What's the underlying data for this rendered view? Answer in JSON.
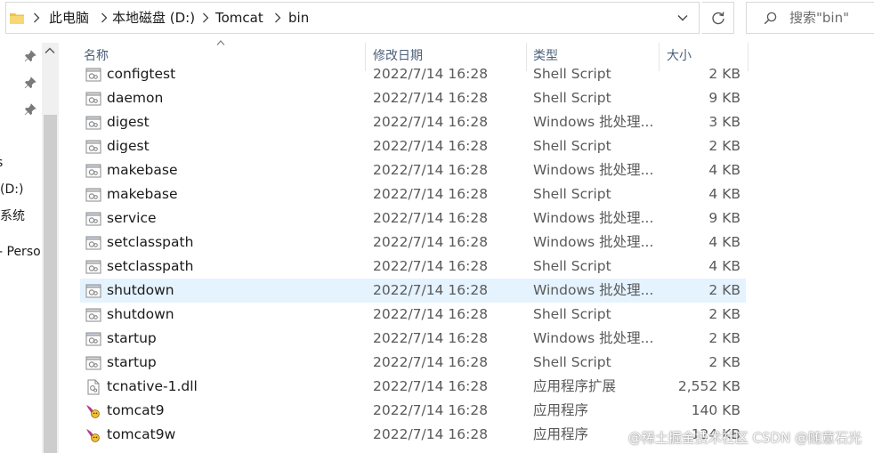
{
  "address_bar": {
    "crumbs": [
      "此电脑",
      "本地磁盘 (D:)",
      "Tomcat",
      "bin"
    ]
  },
  "search": {
    "placeholder": "搜索\"bin\""
  },
  "nav_pane": {
    "labels": [
      "s",
      "(D:)",
      "系统",
      "- Perso"
    ]
  },
  "columns": {
    "name": "名称",
    "date": "修改日期",
    "type": "类型",
    "size": "大小"
  },
  "files": [
    {
      "name": "configtest",
      "date": "2022/7/14 16:28",
      "type": "Shell Script",
      "size": "2 KB",
      "icon": "shell-script-file-icon"
    },
    {
      "name": "daemon",
      "date": "2022/7/14 16:28",
      "type": "Shell Script",
      "size": "9 KB",
      "icon": "shell-script-file-icon"
    },
    {
      "name": "digest",
      "date": "2022/7/14 16:28",
      "type": "Windows 批处理...",
      "size": "3 KB",
      "icon": "batch-file-icon"
    },
    {
      "name": "digest",
      "date": "2022/7/14 16:28",
      "type": "Shell Script",
      "size": "2 KB",
      "icon": "shell-script-file-icon"
    },
    {
      "name": "makebase",
      "date": "2022/7/14 16:28",
      "type": "Windows 批处理...",
      "size": "4 KB",
      "icon": "batch-file-icon"
    },
    {
      "name": "makebase",
      "date": "2022/7/14 16:28",
      "type": "Shell Script",
      "size": "4 KB",
      "icon": "shell-script-file-icon"
    },
    {
      "name": "service",
      "date": "2022/7/14 16:28",
      "type": "Windows 批处理...",
      "size": "9 KB",
      "icon": "batch-file-icon"
    },
    {
      "name": "setclasspath",
      "date": "2022/7/14 16:28",
      "type": "Windows 批处理...",
      "size": "4 KB",
      "icon": "batch-file-icon"
    },
    {
      "name": "setclasspath",
      "date": "2022/7/14 16:28",
      "type": "Shell Script",
      "size": "4 KB",
      "icon": "shell-script-file-icon"
    },
    {
      "name": "shutdown",
      "date": "2022/7/14 16:28",
      "type": "Windows 批处理...",
      "size": "2 KB",
      "icon": "batch-file-icon",
      "selected": true
    },
    {
      "name": "shutdown",
      "date": "2022/7/14 16:28",
      "type": "Shell Script",
      "size": "2 KB",
      "icon": "shell-script-file-icon"
    },
    {
      "name": "startup",
      "date": "2022/7/14 16:28",
      "type": "Windows 批处理...",
      "size": "2 KB",
      "icon": "batch-file-icon"
    },
    {
      "name": "startup",
      "date": "2022/7/14 16:28",
      "type": "Shell Script",
      "size": "2 KB",
      "icon": "shell-script-file-icon"
    },
    {
      "name": "tcnative-1.dll",
      "date": "2022/7/14 16:28",
      "type": "应用程序扩展",
      "size": "2,552 KB",
      "icon": "dll-file-icon"
    },
    {
      "name": "tomcat9",
      "date": "2022/7/14 16:28",
      "type": "应用程序",
      "size": "140 KB",
      "icon": "tomcat-exe-icon"
    },
    {
      "name": "tomcat9w",
      "date": "2022/7/14 16:28",
      "type": "应用程序",
      "size": "124 KB",
      "icon": "tomcat-exe-icon"
    }
  ],
  "watermark": "@稀土掘金技术社区 CSDN @随意石光",
  "colors": {
    "selected_row": "#e5f3ff",
    "header_text": "#4c607a",
    "border": "#d9d9d9"
  }
}
